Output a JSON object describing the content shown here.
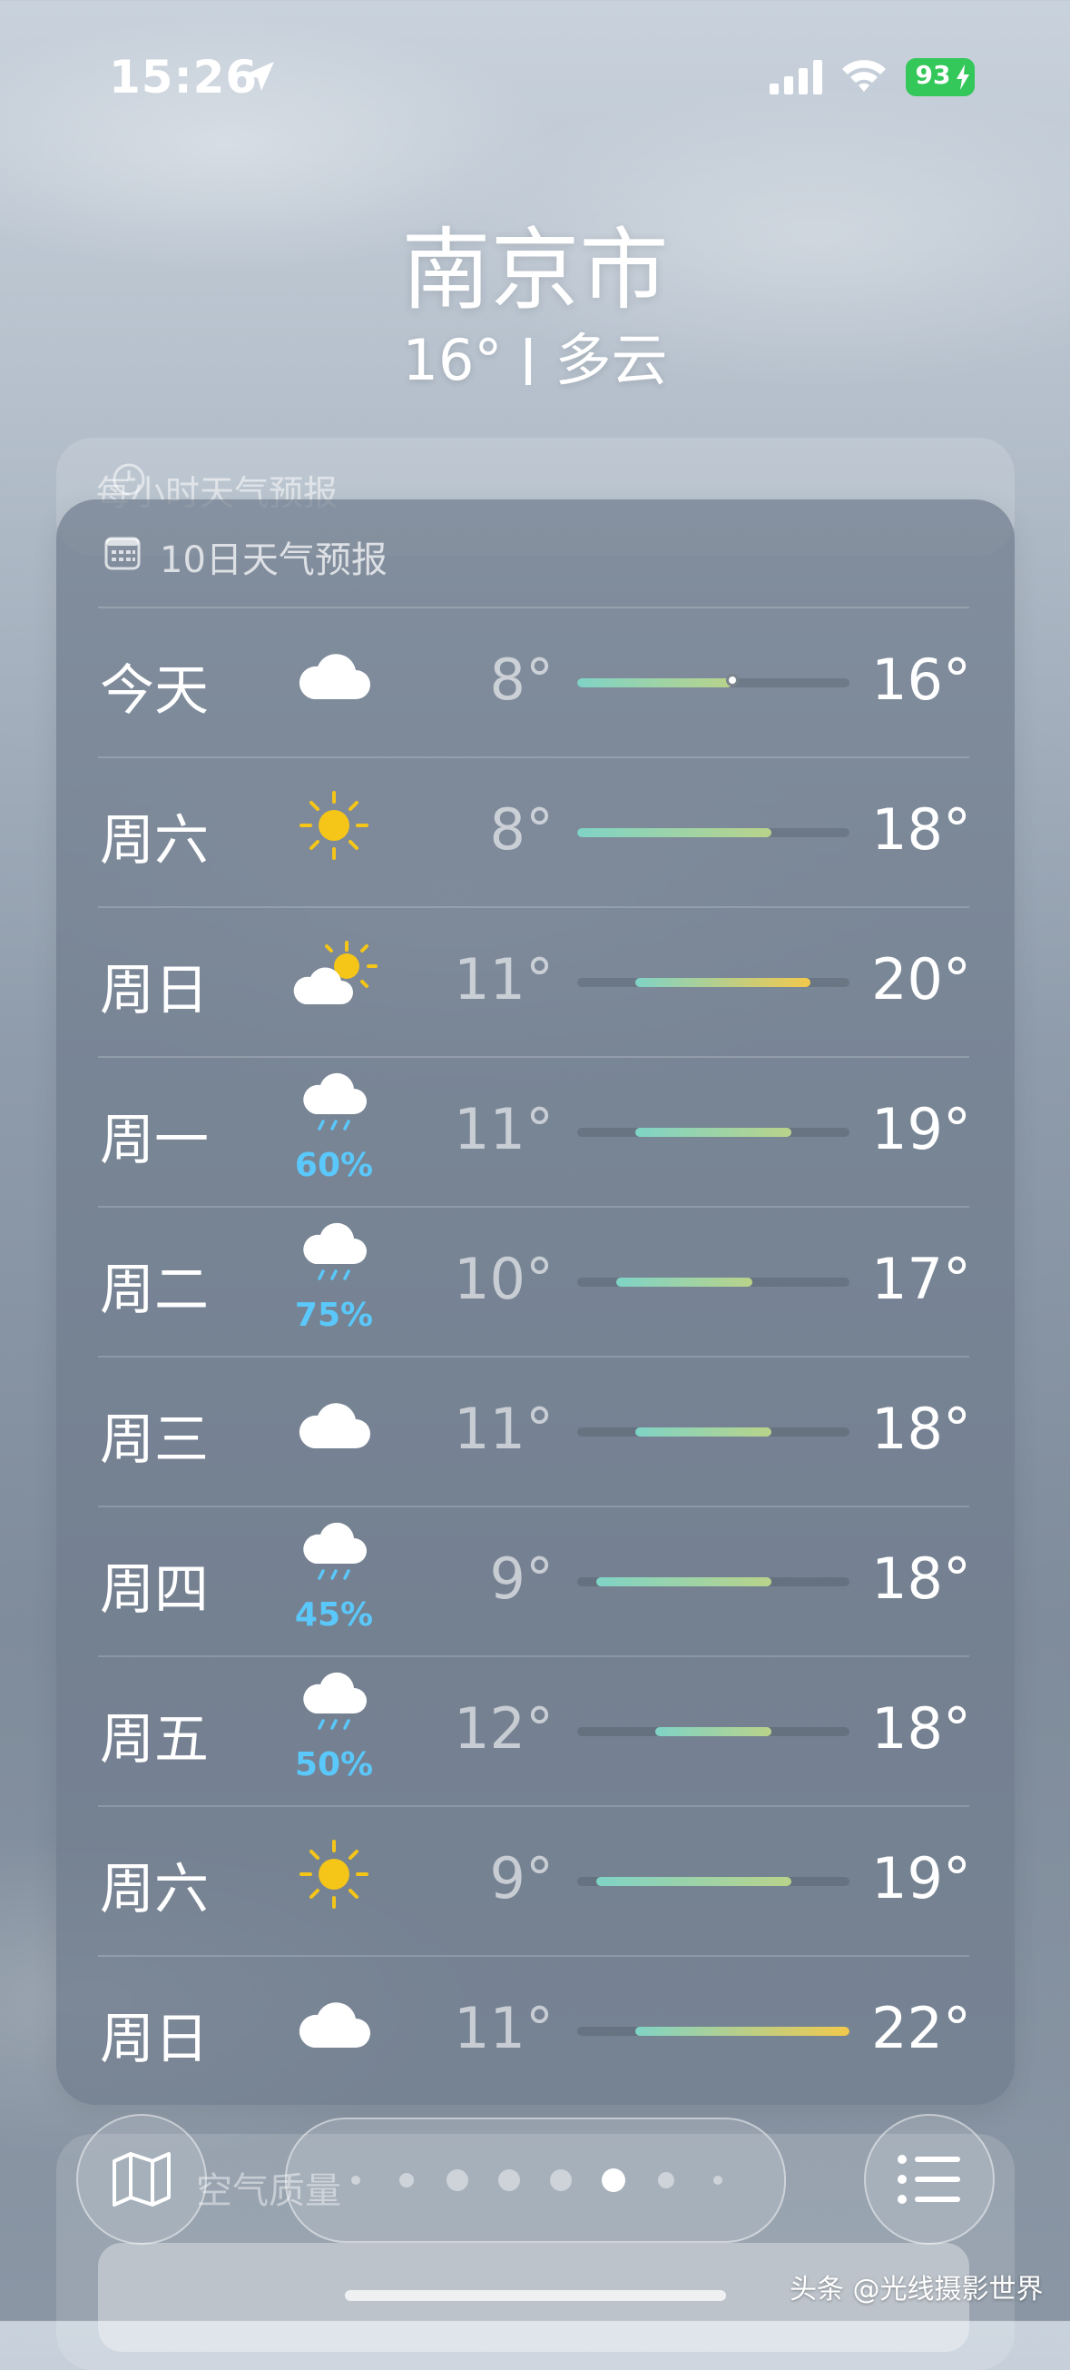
{
  "status_bar": {
    "time": "15:26",
    "battery": "93",
    "battery_color": "#34c759",
    "icons": [
      "location-arrow-icon",
      "cellular-signal-icon",
      "wifi-icon",
      "battery-charging-icon"
    ]
  },
  "header": {
    "city": "南京市",
    "temperature": "16°",
    "condition": "多云"
  },
  "hourly_card": {
    "title": "每小时天气预报",
    "icon": "clock-icon"
  },
  "forecast": {
    "title": "10日天气预报",
    "icon": "calendar-icon",
    "range_min": 8,
    "range_max": 22,
    "current_temp": 16,
    "days": [
      {
        "day": "今天",
        "icon": "cloud-icon",
        "precip": "",
        "low": "8°",
        "high": "16°",
        "low_val": 8,
        "high_val": 16
      },
      {
        "day": "周六",
        "icon": "sun-icon",
        "precip": "",
        "low": "8°",
        "high": "18°",
        "low_val": 8,
        "high_val": 18
      },
      {
        "day": "周日",
        "icon": "partly-sunny-icon",
        "precip": "",
        "low": "11°",
        "high": "20°",
        "low_val": 11,
        "high_val": 20
      },
      {
        "day": "周一",
        "icon": "rain-cloud-icon",
        "precip": "60%",
        "low": "11°",
        "high": "19°",
        "low_val": 11,
        "high_val": 19
      },
      {
        "day": "周二",
        "icon": "rain-cloud-icon",
        "precip": "75%",
        "low": "10°",
        "high": "17°",
        "low_val": 10,
        "high_val": 17
      },
      {
        "day": "周三",
        "icon": "cloud-icon",
        "precip": "",
        "low": "11°",
        "high": "18°",
        "low_val": 11,
        "high_val": 18
      },
      {
        "day": "周四",
        "icon": "rain-cloud-icon",
        "precip": "45%",
        "low": "9°",
        "high": "18°",
        "low_val": 9,
        "high_val": 18
      },
      {
        "day": "周五",
        "icon": "rain-cloud-icon",
        "precip": "50%",
        "low": "12°",
        "high": "18°",
        "low_val": 12,
        "high_val": 18
      },
      {
        "day": "周六",
        "icon": "sun-icon",
        "precip": "",
        "low": "9°",
        "high": "19°",
        "low_val": 9,
        "high_val": 19
      },
      {
        "day": "周日",
        "icon": "cloud-icon",
        "precip": "",
        "low": "11°",
        "high": "22°",
        "low_val": 11,
        "high_val": 22
      }
    ],
    "colors": {
      "cool": "#7fd3c6",
      "mild": "#b9d38a",
      "warm": "#f2c94c",
      "precip": "#5ac8fa"
    }
  },
  "next_card": {
    "title": "空气质量"
  },
  "toolbar": {
    "map_icon": "map-icon",
    "list_icon": "list-icon",
    "page_count": 8,
    "active_page": 5
  },
  "watermark": "头条 @光线摄影世界"
}
